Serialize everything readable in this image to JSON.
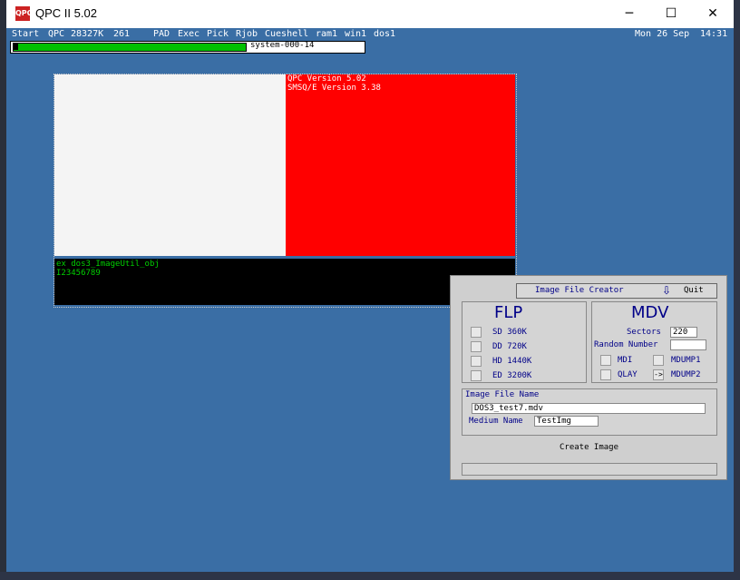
{
  "window": {
    "title": "QPC II 5.02",
    "icon_label": "QPC",
    "minimize_icon": "─",
    "maximize_icon": "☐",
    "close_icon": "✕"
  },
  "qlmenu": {
    "start": "Start",
    "qpc": "QPC",
    "memory": "28327K",
    "count": "261",
    "items": [
      "PAD",
      "Exec",
      "Pick",
      "Rjob",
      "Cueshell",
      "ram1",
      "win1",
      "dos1"
    ],
    "date": "Mon 26 Sep",
    "time": "14:31"
  },
  "status": {
    "text": "system-000-14",
    "progress": 0.66
  },
  "red_pane": {
    "line1": "QPC Version 5.02",
    "line2": "SMSQ/E Version 3.38"
  },
  "console": {
    "line1": "ex dos3_ImageUtil_obj",
    "line2": "I23456789"
  },
  "dialog": {
    "title": "Image File Creator",
    "quit_icon": "⇩",
    "quit": "Quit",
    "flp": {
      "title": "FLP",
      "options": [
        {
          "label": "SD  360K",
          "checked": false
        },
        {
          "label": "DD  720K",
          "checked": false
        },
        {
          "label": "HD  1440K",
          "checked": false
        },
        {
          "label": "ED  3200K",
          "checked": false
        }
      ]
    },
    "mdv": {
      "title": "MDV",
      "sectors_label": "Sectors",
      "sectors_value": "220",
      "random_label": "Random Number",
      "random_value": "",
      "mdi_label": "MDI",
      "mdump1_label": "MDUMP1",
      "qlay_label": "QLAY",
      "mdump2_label": "MDUMP2",
      "mdump2_mark": "->"
    },
    "image_file_label": "Image File Name",
    "image_file_value": "DOS3_test7.mdv",
    "medium_label": "Medium Name",
    "medium_value": "TestImg",
    "create_label": "Create Image"
  },
  "colors": {
    "titlebar": "#ffffff",
    "background": "#3a6ea5",
    "red_pane": "#ff0000",
    "accent": "#000088",
    "progress_fill": "#00c000"
  }
}
